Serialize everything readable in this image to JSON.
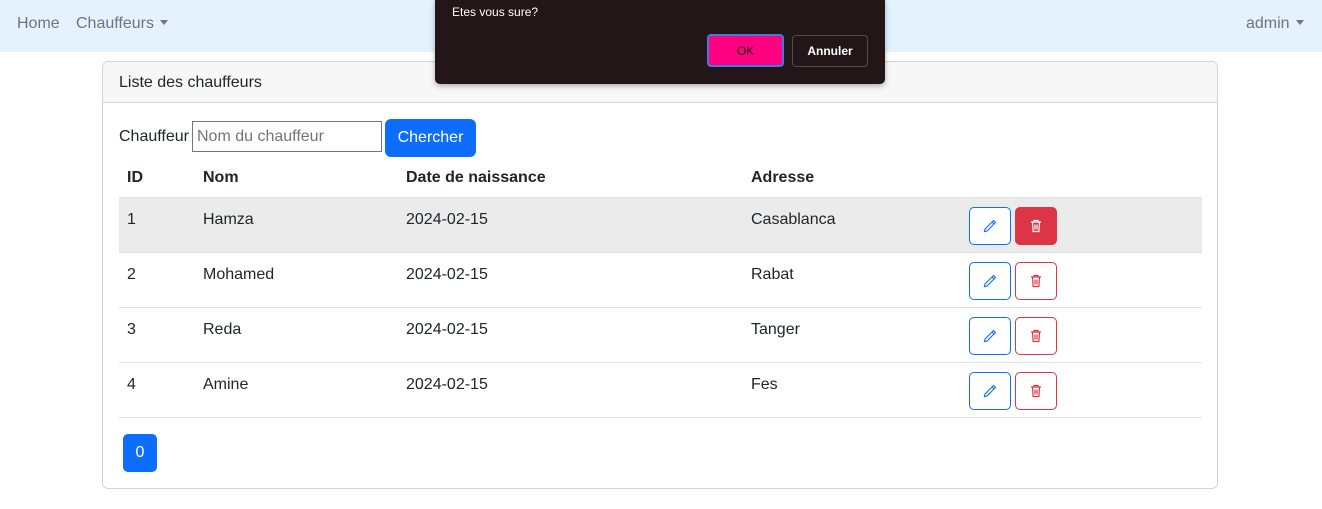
{
  "navbar": {
    "home": "Home",
    "chauffeurs": "Chauffeurs",
    "user": "admin"
  },
  "card": {
    "title": "Liste des chauffeurs",
    "search_label": "Chauffeur",
    "search_value": "",
    "search_placeholder": "Nom du chauffeur",
    "search_button": "Chercher",
    "columns": [
      "ID",
      "Nom",
      "Date de naissance",
      "Adresse"
    ],
    "rows": [
      {
        "id": "1",
        "nom": "Hamza",
        "date": "2024-02-15",
        "adresse": "Casablanca"
      },
      {
        "id": "2",
        "nom": "Mohamed",
        "date": "2024-02-15",
        "adresse": "Rabat"
      },
      {
        "id": "3",
        "nom": "Reda",
        "date": "2024-02-15",
        "adresse": "Tanger"
      },
      {
        "id": "4",
        "nom": "Amine",
        "date": "2024-02-15",
        "adresse": "Fes"
      }
    ],
    "page": "0"
  },
  "dialog": {
    "message": "Etes vous sure?",
    "ok": "OK",
    "cancel": "Annuler"
  },
  "colors": {
    "primary": "#0d6efd",
    "danger": "#dc3545",
    "navbar_bg": "#e3f2fd",
    "dialog_bg": "#231619",
    "ok_bg": "#ff0080"
  },
  "icons": {
    "edit": "pencil-icon",
    "delete": "trash-icon"
  }
}
